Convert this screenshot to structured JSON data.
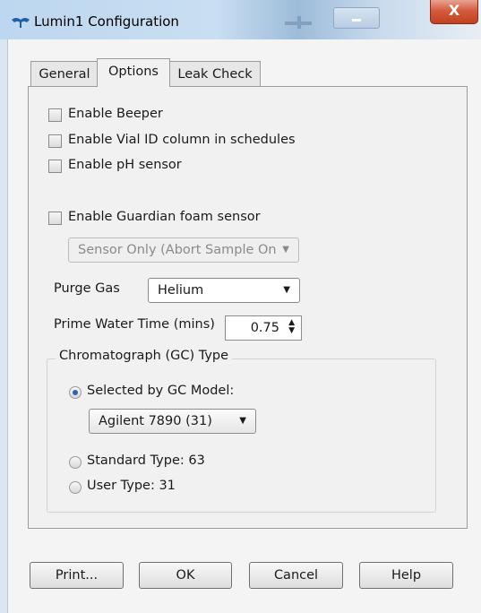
{
  "window": {
    "title": "Lumin1 Configuration",
    "close_label": "X"
  },
  "tabs": [
    {
      "label": "General"
    },
    {
      "label": "Options"
    },
    {
      "label": "Leak Check"
    }
  ],
  "options": {
    "checkboxes": [
      {
        "label": "Enable Beeper",
        "checked": false
      },
      {
        "label": "Enable Vial ID column in schedules",
        "checked": false
      },
      {
        "label": "Enable pH sensor",
        "checked": false
      },
      {
        "label": "Enable Guardian foam sensor",
        "checked": false
      }
    ],
    "foam_mode_value": "Sensor Only (Abort Sample On",
    "purge_gas_label": "Purge Gas",
    "purge_gas_value": "Helium",
    "prime_water_label": "Prime Water Time (mins)",
    "prime_water_value": "0.75"
  },
  "gc_type": {
    "group_title": "Chromatograph (GC) Type",
    "radios": [
      {
        "label": "Selected by GC Model:",
        "checked": true
      },
      {
        "label": "Standard Type: 63",
        "checked": false
      },
      {
        "label": "User Type: 31",
        "checked": false
      }
    ],
    "model_value": "Agilent 7890 (31)"
  },
  "buttons": {
    "print": "Print...",
    "ok": "OK",
    "cancel": "Cancel",
    "help": "Help"
  }
}
